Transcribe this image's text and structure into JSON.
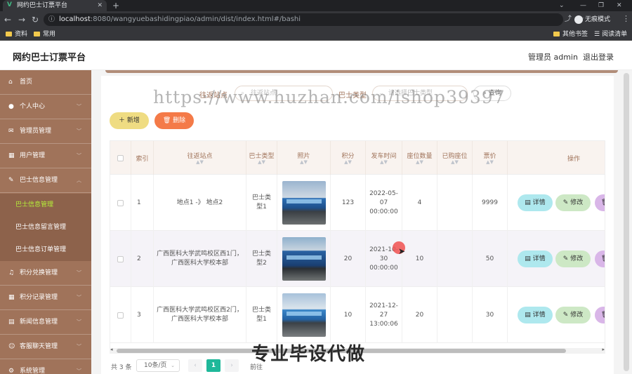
{
  "browser": {
    "tab_title": "网约巴士订票平台",
    "tab_favicon": "V",
    "url_host": "localhost",
    "url_path": ":8080/wangyuebashidingpiao/admin/dist/index.html#/bashi",
    "incognito_label": "无痕模式",
    "bookmarks": [
      {
        "label": "资料"
      },
      {
        "label": "常用"
      }
    ],
    "bookmarks_right": [
      {
        "label": "其他书签"
      },
      {
        "label": "阅读清单"
      }
    ]
  },
  "header": {
    "title": "网约巴士订票平台",
    "admin": "管理员 admin",
    "logout": "退出登录"
  },
  "sidebar": {
    "items": [
      {
        "label": "首页",
        "icon": "home-icon"
      },
      {
        "label": "个人中心",
        "icon": "user-icon"
      },
      {
        "label": "管理员管理",
        "icon": "mail-icon"
      },
      {
        "label": "用户管理",
        "icon": "grid-icon"
      },
      {
        "label": "巴士信息管理",
        "icon": "edit-icon"
      }
    ],
    "subitems": [
      {
        "label": "巴士信息管理"
      },
      {
        "label": "巴士信息留言管理"
      },
      {
        "label": "巴士信息订单管理"
      }
    ],
    "items_after": [
      {
        "label": "积分兑换管理",
        "icon": "bell-icon"
      },
      {
        "label": "积分记录管理",
        "icon": "grid-icon"
      },
      {
        "label": "新闻信息管理",
        "icon": "news-icon"
      },
      {
        "label": "客服聊天管理",
        "icon": "chat-icon"
      },
      {
        "label": "系统管理",
        "icon": "gear-icon"
      }
    ]
  },
  "search": {
    "station_label": "往返站点",
    "station_placeholder": "往返站点",
    "bustype_label": "巴士类型",
    "bustype_placeholder": "请选择巴士类型",
    "query_label": "查询"
  },
  "actions": {
    "add_label": "新增",
    "delete_label": "删除"
  },
  "table": {
    "headers": [
      "索引",
      "往返站点",
      "巴士类型",
      "照片",
      "积分",
      "发车时间",
      "座位数量",
      "已购座位",
      "票价",
      "操作"
    ],
    "rows": [
      {
        "index": "1",
        "station": "地点1 -》 地点2",
        "bustype": "巴士类型1",
        "points": "123",
        "time": "2022-05-07 00:00:00",
        "seats": "4",
        "booked": "",
        "price": "9999"
      },
      {
        "index": "2",
        "station": "广西医科大学武鸣校区西1门，广西医科大学校本部",
        "bustype": "巴士类型2",
        "points": "20",
        "time": "2021-10-30 00:00:00",
        "seats": "10",
        "booked": "",
        "price": "50"
      },
      {
        "index": "3",
        "station": "广西医科大学武鸣校区西2门，广西医科大学校本部",
        "bustype": "巴士类型1",
        "points": "10",
        "time": "2021-12-27 13:00:06",
        "seats": "20",
        "booked": "",
        "price": "30"
      }
    ],
    "op_detail": "详情",
    "op_edit": "修改",
    "op_delete": "删除"
  },
  "pagination": {
    "total": "共 3 条",
    "page_size": "10条/页",
    "current_page": "1",
    "goto_label": "前往"
  },
  "overlay": {
    "watermark": "https://www.huzhan.com/ishop39397",
    "banner": "专业毕设代做"
  },
  "colors": {
    "sidebar": "#a0735a",
    "active_sub": "#b6f23a",
    "add": "#efdc82",
    "delete": "#f47a48",
    "page_active": "#1fb89a"
  }
}
